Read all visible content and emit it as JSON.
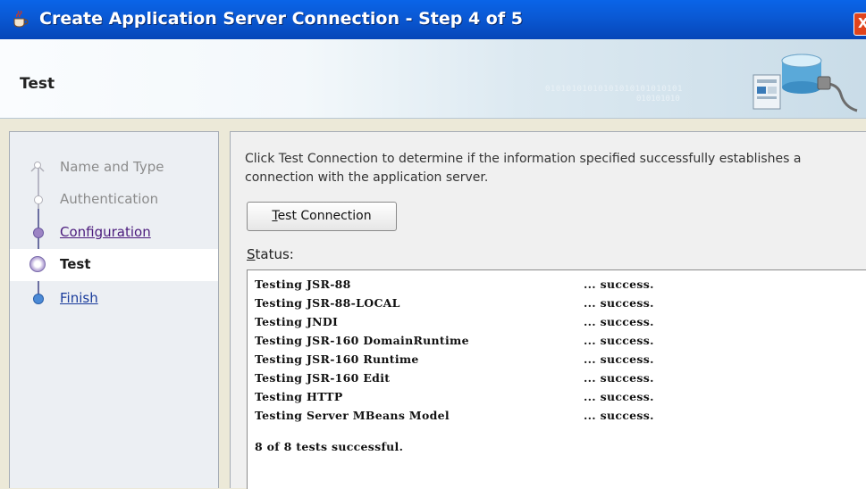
{
  "window": {
    "title": "Create Application Server Connection - Step 4 of 5",
    "close_glyph": "X"
  },
  "header": {
    "page_title": "Test",
    "binary_text_1": "01010101010101010101010101",
    "binary_text_2": "010101010"
  },
  "steps": [
    {
      "label": "Name and Type",
      "state": "done"
    },
    {
      "label": "Authentication",
      "state": "done"
    },
    {
      "label": "Configuration",
      "state": "link"
    },
    {
      "label": "Test",
      "state": "current"
    },
    {
      "label": "Finish",
      "state": "link"
    }
  ],
  "main": {
    "description": "Click Test Connection to determine if the information specified successfully establishes a connection with the application server.",
    "test_button_label_mnemonic": "T",
    "test_button_label_rest": "est Connection",
    "status_label_mnemonic": "S",
    "status_label_rest": "tatus:"
  },
  "status": {
    "lines": [
      {
        "test": "Testing JSR-88",
        "result": "... success."
      },
      {
        "test": "Testing JSR-88-LOCAL",
        "result": "... success."
      },
      {
        "test": "Testing JNDI",
        "result": "... success."
      },
      {
        "test": "Testing JSR-160 DomainRuntime",
        "result": "... success."
      },
      {
        "test": "Testing JSR-160 Runtime",
        "result": "... success."
      },
      {
        "test": "Testing JSR-160 Edit",
        "result": "... success."
      },
      {
        "test": "Testing HTTP",
        "result": "... success."
      },
      {
        "test": "Testing Server MBeans Model",
        "result": "... success."
      }
    ],
    "summary": "8 of 8 tests successful."
  },
  "colors": {
    "titlebar_blue": "#0a5ad6",
    "link_purple": "#4a1a7c",
    "finish_blue": "#1a3c9c"
  },
  "icons": {
    "app_icon": "java-cup-icon",
    "header_graphic": "server-database-icon",
    "close": "close-icon"
  }
}
